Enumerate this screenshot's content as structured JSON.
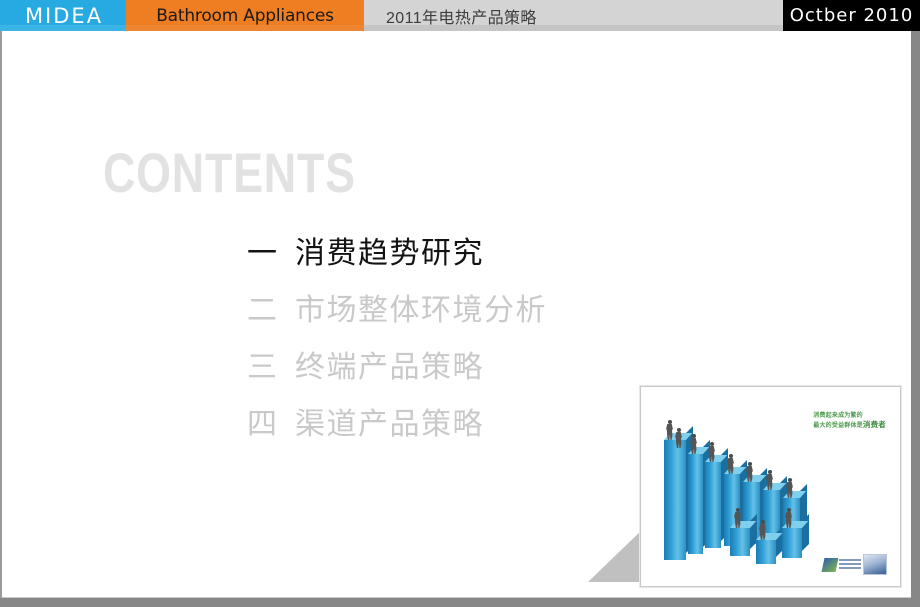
{
  "header": {
    "brand": "MIDEA",
    "division": "Bathroom Appliances",
    "title": "2011年电热产品策略",
    "date": "Octber  2010",
    "colors": {
      "brand_bg": "#27a9e1",
      "division_bg": "#ef7d22",
      "title_bg": "#d4d4d4",
      "date_bg": "#000000"
    }
  },
  "contents": {
    "heading": "CONTENTS",
    "heading_color": "#e2e2e2",
    "items": [
      {
        "num": "一",
        "label": "消费趋势研究",
        "state": "active"
      },
      {
        "num": "二",
        "label": "市场整体环境分析",
        "state": "dim"
      },
      {
        "num": "三",
        "label": "终端产品策略",
        "state": "dim"
      },
      {
        "num": "四",
        "label": "渠道产品策略",
        "state": "dim"
      }
    ],
    "active_color": "#131313",
    "dim_color": "#c9c9c9"
  },
  "picture": {
    "caption_line1": "消费起来成为繁的",
    "caption_line2": "最大的受益群体是",
    "caption_highlight": "消费者",
    "caption_color": "#4e9a4e",
    "bar_color": "#2f9ed4"
  }
}
